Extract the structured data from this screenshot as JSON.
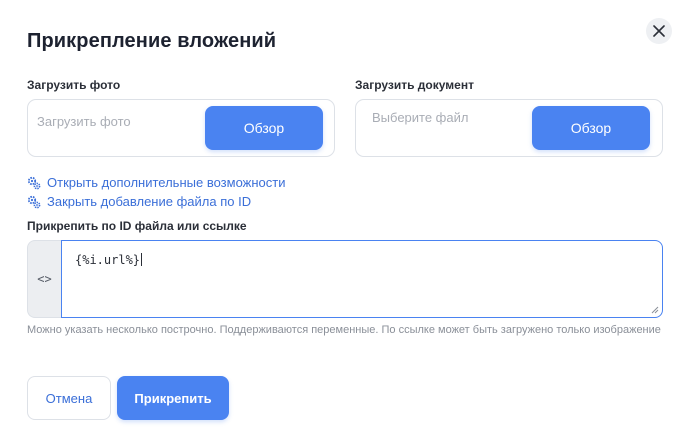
{
  "dialog": {
    "title": "Прикрепление вложений",
    "close_icon": "close-icon"
  },
  "photo_upload": {
    "label": "Загрузить фото",
    "placeholder": "Загрузить фото",
    "browse_label": "Обзор"
  },
  "document_upload": {
    "label": "Загрузить документ",
    "placeholder": "Выберите файл",
    "browse_label": "Обзор"
  },
  "links": {
    "open_more": {
      "icon": "gears-icon",
      "label": "Открыть дополнительные возможности"
    },
    "close_id": {
      "icon": "gears-icon",
      "label": "Закрыть добавление файла по ID"
    }
  },
  "attach_by_id": {
    "label": "Прикрепить по ID файла или ссылке",
    "gutter_symbol": "<>",
    "value": "{%i.url%}",
    "hint": "Можно указать несколько построчно. Поддерживаются переменные. По ссылке может быть загружено только изображение"
  },
  "actions": {
    "cancel_label": "Отмена",
    "attach_label": "Прикрепить"
  },
  "colors": {
    "accent": "#4a83f1",
    "link": "#3b6fd8"
  }
}
